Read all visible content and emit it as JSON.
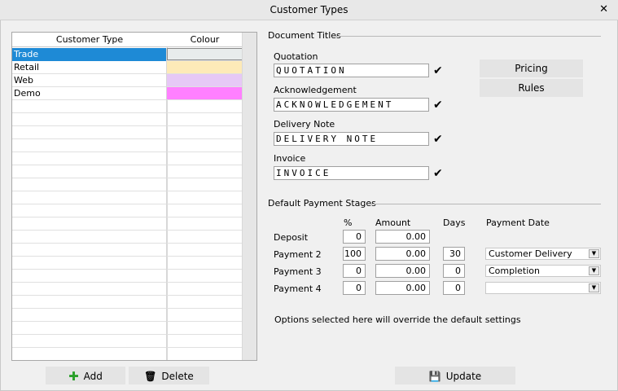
{
  "window": {
    "title": "Customer Types"
  },
  "grid": {
    "headers": [
      "Customer Type",
      "Colour"
    ],
    "rows": [
      {
        "name": "Trade",
        "colour": "#e8ecec"
      },
      {
        "name": "Retail",
        "colour": "#fdeab8"
      },
      {
        "name": "Web",
        "colour": "#e6c8f6"
      },
      {
        "name": "Demo",
        "colour": "#ff80ff"
      }
    ],
    "selected_index": 0
  },
  "buttons": {
    "add": "Add",
    "delete": "Delete",
    "update": "Update",
    "pricing": "Pricing",
    "rules": "Rules"
  },
  "document_titles": {
    "section_label": "Document Titles",
    "fields": [
      {
        "label": "Quotation",
        "value": "QUOTATION"
      },
      {
        "label": "Acknowledgement",
        "value": "ACKNOWLEDGEMENT"
      },
      {
        "label": "Delivery Note",
        "value": "DELIVERY NOTE"
      },
      {
        "label": "Invoice",
        "value": "INVOICE"
      }
    ]
  },
  "payment_stages": {
    "section_label": "Default Payment Stages",
    "headers": {
      "percent": "%",
      "amount": "Amount",
      "days": "Days",
      "payment_date": "Payment Date"
    },
    "rows": [
      {
        "label": "Deposit",
        "percent": "0",
        "amount": "0.00",
        "days": null,
        "payment_date": null
      },
      {
        "label": "Payment 2",
        "percent": "100",
        "amount": "0.00",
        "days": "30",
        "payment_date": "Customer Delivery"
      },
      {
        "label": "Payment 3",
        "percent": "0",
        "amount": "0.00",
        "days": "0",
        "payment_date": "Completion"
      },
      {
        "label": "Payment 4",
        "percent": "0",
        "amount": "0.00",
        "days": "0",
        "payment_date": ""
      }
    ],
    "note": "Options selected here will override the default settings"
  },
  "icons": {
    "close": "close-icon",
    "add": "plus-icon",
    "delete": "delete-icon",
    "update": "save-icon",
    "check": "check-icon",
    "dropdown": "chevron-down-icon"
  },
  "colors": {
    "selection": "#1e8ad6",
    "add_icon": "#2aa02a"
  }
}
